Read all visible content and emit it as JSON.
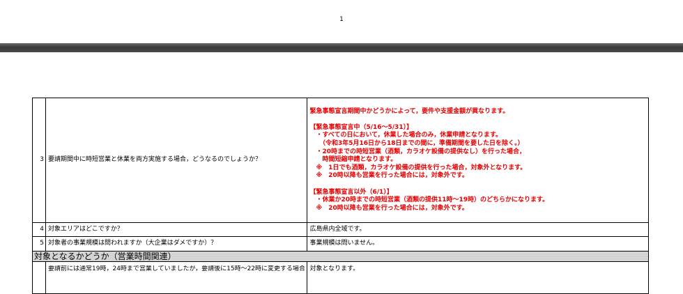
{
  "page": {
    "number": "1"
  },
  "rows": [
    {
      "num": "3",
      "question": "要請期間中に時短営業と休業を両方実施する場合，どうなるのでしょうか？",
      "answer_lines": [
        "緊急事態宣言期間中かどうかによって，要件や支援金額が異なります。",
        "",
        "【緊急事態宣言中（5/16〜5/31）】",
        "　・すべての日において，休業した場合のみ，休業申請となります。",
        "　　（令和3年5月16日から18日までの間に，準備期間を要した日を除く。）",
        "　・20時までの時短営業（酒類，カラオケ設備の提供なし）を行った場合，",
        "　　時間短縮申請となります。",
        "　※　1日でも酒類，カラオケ設備の提供を行った場合，対象外となります。",
        "　※　20時以降も営業を行った場合には，対象外です。",
        "",
        "【緊急事態宣言以外（6/1）】",
        "　・休業か20時までの時短営業（酒類の提供11時〜19時）のどちらかになります。",
        "　※　20時以降も営業を行った場合には，対象外です。"
      ]
    },
    {
      "num": "4",
      "question": "対象エリアはどこですか？",
      "answer": "広島県内全域です。"
    },
    {
      "num": "5",
      "question": "対象者の事業規模は問われますか（大企業はダメですか）？",
      "answer": "事業規模は問いません。"
    }
  ],
  "section": {
    "title": "対象となるかどうか（営業時間関連）"
  },
  "row6": {
    "question_partial": "要請前には通常19時，24時まで営業していましたが，要請後に15時～22時に変更する場合",
    "answer": "対象となります。"
  },
  "colors": {
    "answer_highlight": "#e60000",
    "section_bg": "#d4d4d4",
    "page_gap": "#4a4a4a"
  }
}
